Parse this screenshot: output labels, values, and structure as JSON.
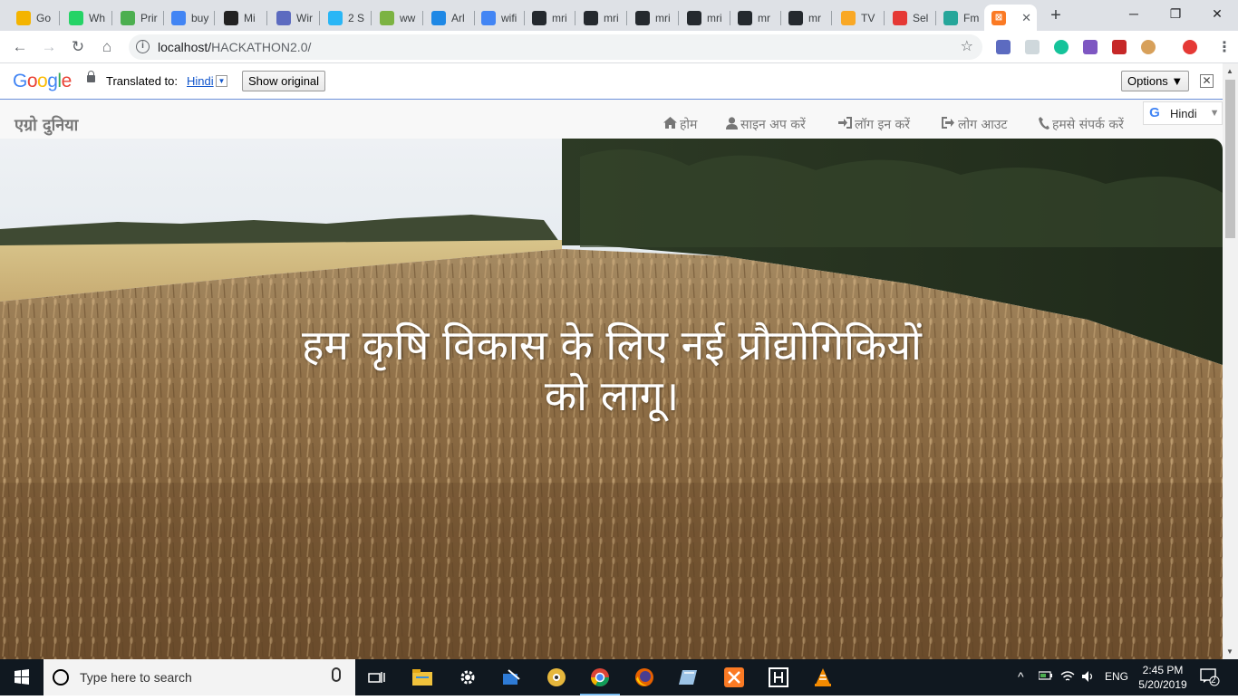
{
  "browser": {
    "tabs": [
      {
        "label": "Go",
        "icon": "bulb-icon",
        "color": "#f4b400"
      },
      {
        "label": "Wh",
        "icon": "whatsapp-icon",
        "color": "#25d366"
      },
      {
        "label": "Prir",
        "icon": "play-icon",
        "color": "#4caf50"
      },
      {
        "label": "buy",
        "icon": "google-icon",
        "color": "#4285f4"
      },
      {
        "label": "Mi",
        "icon": "amazon-icon",
        "color": "#222222"
      },
      {
        "label": "Wir",
        "icon": "shield-icon",
        "color": "#5c6bc0"
      },
      {
        "label": "2 S",
        "icon": "chat-icon",
        "color": "#29b6f6"
      },
      {
        "label": "ww",
        "icon": "w-icon",
        "color": "#7cb342"
      },
      {
        "label": "Arl",
        "icon": "salesforce-icon",
        "color": "#1e88e5"
      },
      {
        "label": "wifi",
        "icon": "google-icon",
        "color": "#4285f4"
      },
      {
        "label": "mri",
        "icon": "github-icon",
        "color": "#24292e"
      },
      {
        "label": "mri",
        "icon": "github-icon",
        "color": "#24292e"
      },
      {
        "label": "mri",
        "icon": "github-icon",
        "color": "#24292e"
      },
      {
        "label": "mri",
        "icon": "github-icon",
        "color": "#24292e"
      },
      {
        "label": "mr",
        "icon": "github-icon",
        "color": "#24292e"
      },
      {
        "label": "mr",
        "icon": "github-icon",
        "color": "#24292e"
      },
      {
        "label": "TV",
        "icon": "tv-icon",
        "color": "#f9a825"
      },
      {
        "label": "Sel",
        "icon": "brave-icon",
        "color": "#e53935"
      },
      {
        "label": "Fm",
        "icon": "play-icon",
        "color": "#26a69a"
      }
    ],
    "active_tab_icon": "xampp-icon",
    "url_host": "localhost/",
    "url_path": "HACKATHON2.0/"
  },
  "translate_bar": {
    "logo": [
      "G",
      "o",
      "o",
      "g",
      "l",
      "e"
    ],
    "translated_to": "Translated to:",
    "language": "Hindi",
    "show_original": "Show original",
    "options": "Options ▼"
  },
  "site": {
    "brand": "एग्रो दुनिया",
    "nav": [
      {
        "label": "होम",
        "icon": "home-icon"
      },
      {
        "label": "साइन अप करें",
        "icon": "user-icon"
      },
      {
        "label": "लॉग इन करें",
        "icon": "login-icon"
      },
      {
        "label": "लोग आउट",
        "icon": "logout-icon"
      },
      {
        "label": "हमसे संपर्क करें",
        "icon": "phone-icon"
      }
    ],
    "translate_widget": "Hindi",
    "hero_line1": "हम कृषि विकास के लिए नई प्रौद्योगिकियों",
    "hero_line2": "को लागू।"
  },
  "taskbar": {
    "search_placeholder": "Type here to search",
    "lang": "ENG",
    "time": "2:45 PM",
    "date": "5/20/2019",
    "notifications": "2"
  }
}
